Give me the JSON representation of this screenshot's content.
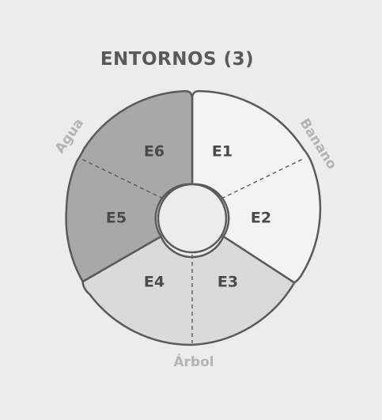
{
  "title": "ENTORNOS (3)",
  "colors": {
    "background": "#ececec",
    "stroke": "#5a5a5a",
    "dark": "#a8a8a8",
    "medium": "#dadada",
    "light": "#f3f3f3",
    "group_text": "#b4b4b4",
    "label_text": "#4a4a4a"
  },
  "groups": [
    {
      "label": "Banano",
      "segments": [
        "E1",
        "E2"
      ],
      "fill": "light"
    },
    {
      "label": "Árbol",
      "segments": [
        "E3",
        "E4"
      ],
      "fill": "medium"
    },
    {
      "label": "Agua",
      "segments": [
        "E5",
        "E6"
      ],
      "fill": "dark"
    }
  ]
}
